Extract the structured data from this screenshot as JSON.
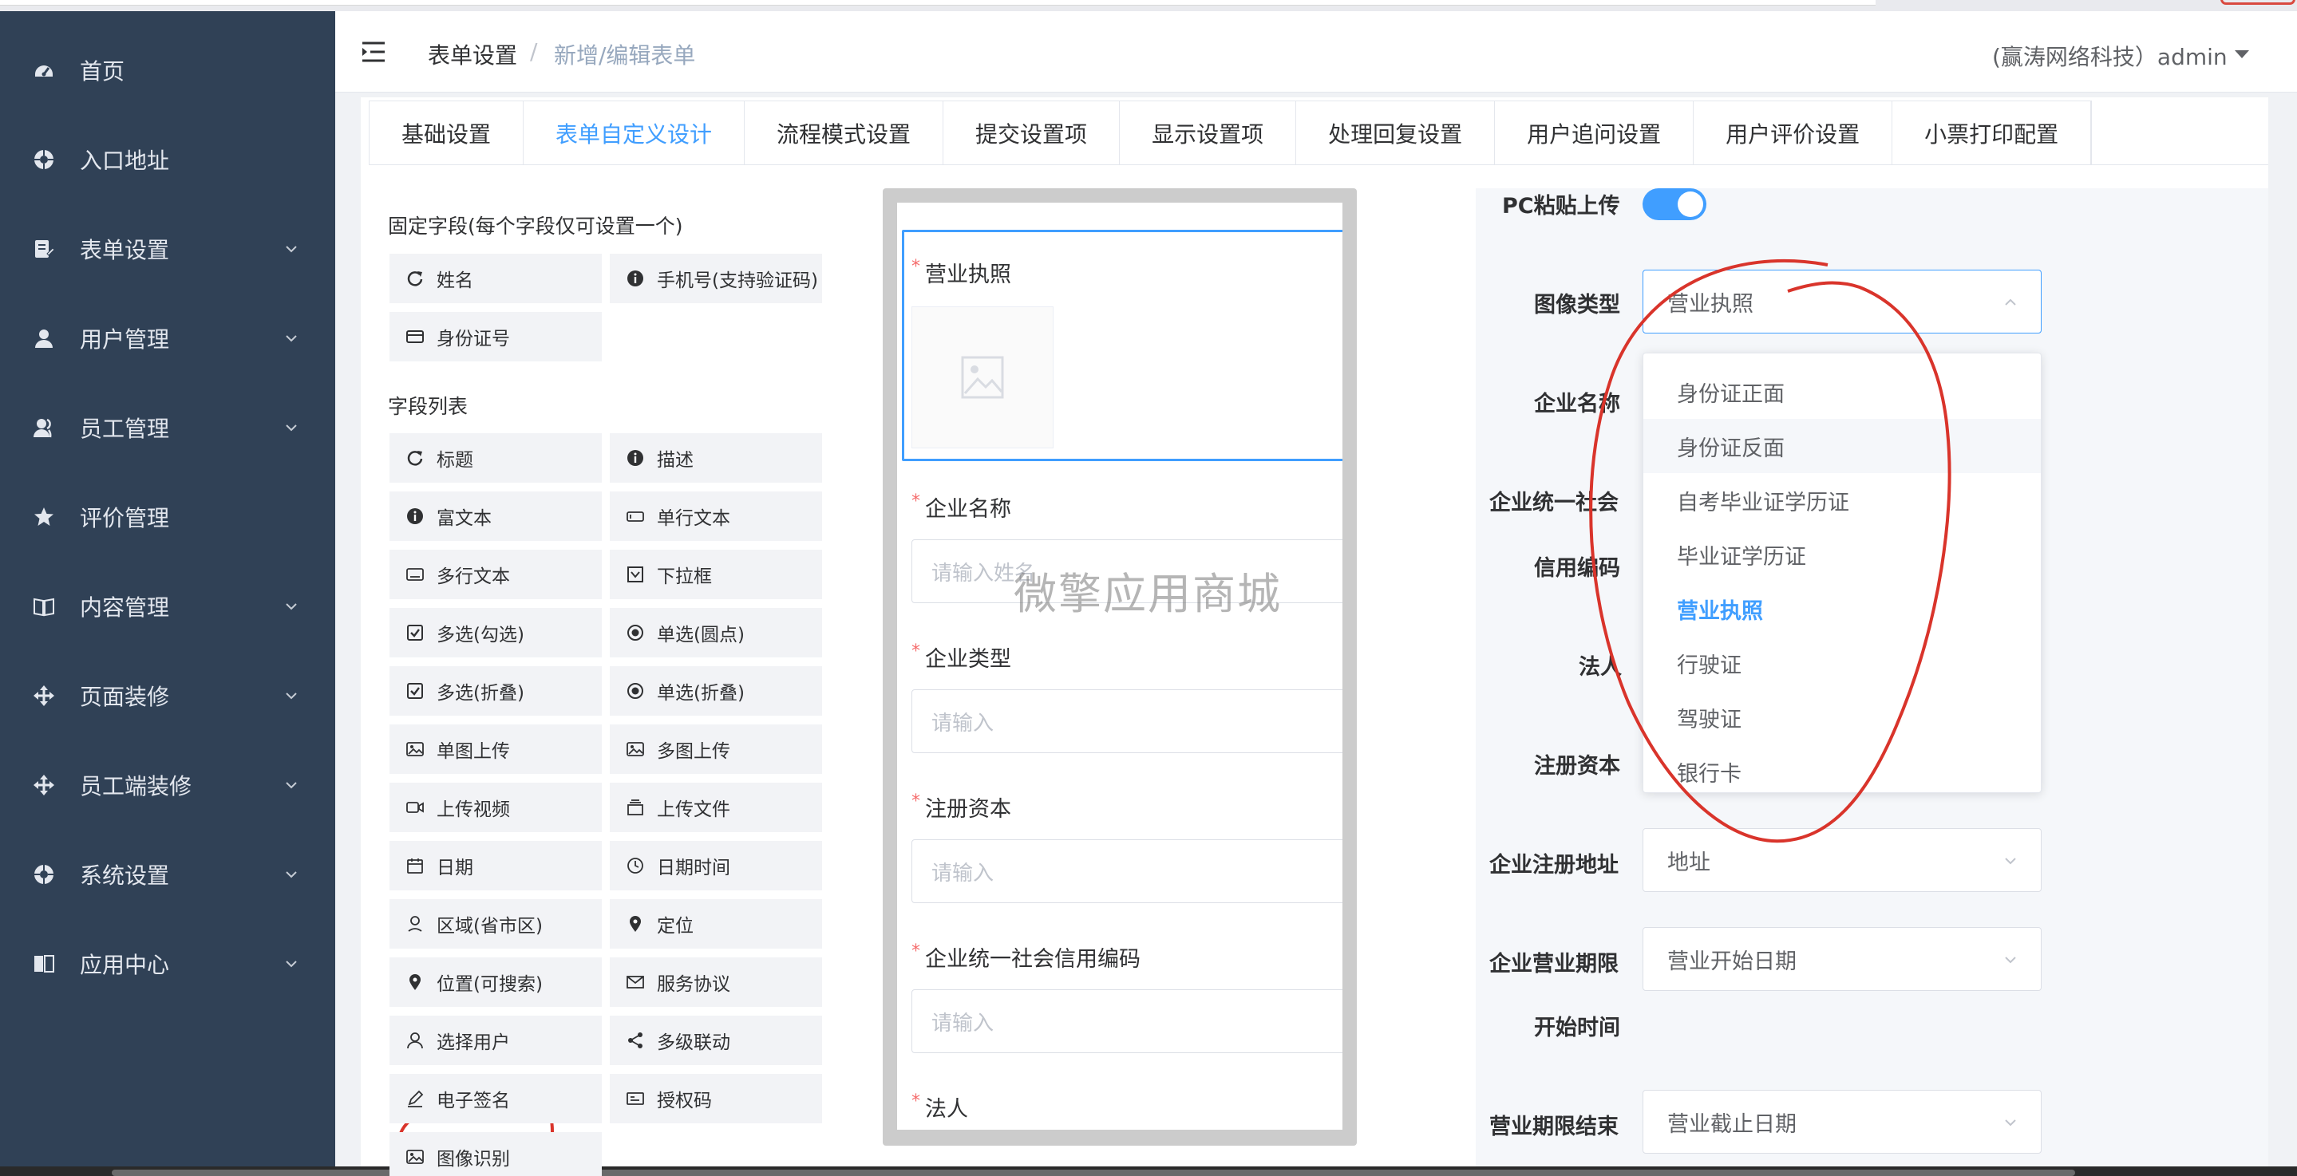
{
  "sidebar": {
    "items": [
      {
        "label": "首页",
        "icon": "dashboard-icon",
        "has_arrow": false
      },
      {
        "label": "入口地址",
        "icon": "aperture-icon",
        "has_arrow": false
      },
      {
        "label": "表单设置",
        "icon": "form-edit-icon",
        "has_arrow": true
      },
      {
        "label": "用户管理",
        "icon": "user-icon",
        "has_arrow": true
      },
      {
        "label": "员工管理",
        "icon": "staff-icon",
        "has_arrow": true
      },
      {
        "label": "评价管理",
        "icon": "star-icon",
        "has_arrow": false
      },
      {
        "label": "内容管理",
        "icon": "book-icon",
        "has_arrow": true
      },
      {
        "label": "页面装修",
        "icon": "move-icon",
        "has_arrow": true
      },
      {
        "label": "员工端装修",
        "icon": "move-icon",
        "has_arrow": true
      },
      {
        "label": "系统设置",
        "icon": "aperture-icon",
        "has_arrow": true
      },
      {
        "label": "应用中心",
        "icon": "reader-icon",
        "has_arrow": true
      }
    ]
  },
  "header": {
    "breadcrumb_parent": "表单设置",
    "breadcrumb_sep": "/",
    "breadcrumb_current": "新增/编辑表单",
    "user": "(赢涛网络科技）admin"
  },
  "tabs": [
    "基础设置",
    "表单自定义设计",
    "流程模式设置",
    "提交设置项",
    "显示设置项",
    "处理回复设置",
    "用户追问设置",
    "用户评价设置",
    "小票打印配置"
  ],
  "active_tab": "表单自定义设计",
  "palette": {
    "fixed_title": "固定字段(每个字段仅可设置一个)",
    "fixed_fields": [
      {
        "label": "姓名",
        "icon": "refresh-icon"
      },
      {
        "label": "手机号(支持验证码)",
        "icon": "info-icon"
      },
      {
        "label": "身份证号",
        "icon": "id-card-icon"
      }
    ],
    "list_title": "字段列表",
    "fields": [
      {
        "label": "标题",
        "icon": "refresh-icon"
      },
      {
        "label": "描述",
        "icon": "info-icon"
      },
      {
        "label": "富文本",
        "icon": "info-icon"
      },
      {
        "label": "单行文本",
        "icon": "input-icon"
      },
      {
        "label": "多行文本",
        "icon": "textarea-icon"
      },
      {
        "label": "下拉框",
        "icon": "dropdown-box-icon"
      },
      {
        "label": "多选(勾选)",
        "icon": "checkbox-icon"
      },
      {
        "label": "单选(圆点)",
        "icon": "radio-icon"
      },
      {
        "label": "多选(折叠)",
        "icon": "checkbox-icon"
      },
      {
        "label": "单选(折叠)",
        "icon": "radio-icon"
      },
      {
        "label": "单图上传",
        "icon": "image-icon"
      },
      {
        "label": "多图上传",
        "icon": "image-icon"
      },
      {
        "label": "上传视频",
        "icon": "video-icon"
      },
      {
        "label": "上传文件",
        "icon": "file-icon"
      },
      {
        "label": "日期",
        "icon": "calendar-icon"
      },
      {
        "label": "日期时间",
        "icon": "clock-icon"
      },
      {
        "label": "区域(省市区)",
        "icon": "region-icon"
      },
      {
        "label": "定位",
        "icon": "location-icon"
      },
      {
        "label": "位置(可搜索)",
        "icon": "location-icon"
      },
      {
        "label": "服务协议",
        "icon": "mail-icon"
      },
      {
        "label": "选择用户",
        "icon": "user-outline-icon"
      },
      {
        "label": "多级联动",
        "icon": "share-icon"
      },
      {
        "label": "电子签名",
        "icon": "pen-icon"
      },
      {
        "label": "授权码",
        "icon": "code-card-icon"
      },
      {
        "label": "图像识别",
        "icon": "image-icon"
      }
    ]
  },
  "preview": {
    "fields": [
      {
        "label": "营业执照",
        "type": "image"
      },
      {
        "label": "企业名称",
        "placeholder": "请输入姓名"
      },
      {
        "label": "企业类型",
        "placeholder": "请输入"
      },
      {
        "label": "注册资本",
        "placeholder": "请输入"
      },
      {
        "label": "企业统一社会信用编码",
        "placeholder": "请输入"
      },
      {
        "label": "法人",
        "placeholder": ""
      }
    ],
    "watermark": "微擎应用商城"
  },
  "properties": {
    "pc_paste_label": "PC粘贴上传",
    "pc_paste_on": true,
    "image_type_label": "图像类型",
    "image_type_value": "营业执照",
    "company_name_label": "企业名称",
    "credit_code_label_1": "企业统一社会",
    "credit_code_label_2": "信用编码",
    "legal_label": "法人",
    "capital_label": "注册资本",
    "address_label": "企业注册地址",
    "address_value": "地址",
    "period_start_label_1": "企业营业期限",
    "period_start_label_2": "开始时间",
    "period_start_value": "营业开始日期",
    "period_end_label": "营业期限结束",
    "period_end_value": "营业截止日期"
  },
  "dropdown": {
    "options": [
      "身份证正面",
      "身份证反面",
      "自考毕业证学历证",
      "毕业证学历证",
      "营业执照",
      "行驶证",
      "驾驶证",
      "银行卡"
    ],
    "selected": "营业执照",
    "hovered": "身份证反面"
  },
  "colors": {
    "sidebar_bg": "#304156",
    "primary": "#409eff",
    "required": "#f56c6c",
    "annotation": "#d9342b"
  }
}
